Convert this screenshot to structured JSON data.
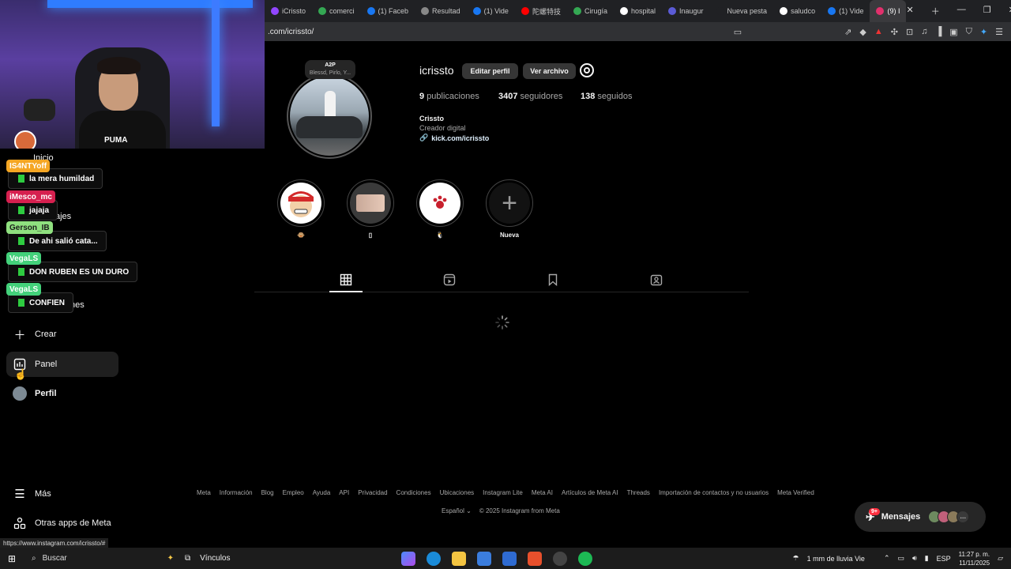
{
  "browser": {
    "tabs": [
      {
        "label": "iCrissto",
        "color": "#9146ff"
      },
      {
        "label": "comerci",
        "color": "#34a853"
      },
      {
        "label": "(1) Faceb",
        "color": "#1877f2"
      },
      {
        "label": "Resultad",
        "color": "#888888"
      },
      {
        "label": "(1) Vide",
        "color": "#1877f2"
      },
      {
        "label": "陀螺特技",
        "color": "#ff0000"
      },
      {
        "label": "Cirugía",
        "color": "#34a853"
      },
      {
        "label": "hospital",
        "color": "#ffffff"
      },
      {
        "label": "Inaugur",
        "color": "#5b5bd6"
      },
      {
        "label": "Nueva pesta",
        "color": "#202124"
      },
      {
        "label": "saludco",
        "color": "#ffffff"
      },
      {
        "label": "(1) Vide",
        "color": "#1877f2"
      },
      {
        "label": "(9) I",
        "color": "#e1306c"
      }
    ],
    "address": ".com/icrissto/",
    "status_url": "https://www.instagram.com/icrissto/#"
  },
  "stream": {
    "shirt_text": "PUMA",
    "chat": [
      {
        "user": "IS4NTYoff",
        "user_color": "#f5a623",
        "text_color": "#ffffff",
        "msg": "la mera humildad"
      },
      {
        "user": "iMesco_mc",
        "user_color": "#d6204f",
        "text_color": "#ffffff",
        "msg": "jajaja"
      },
      {
        "user": "Gerson_IB",
        "user_color": "#8fe07f",
        "text_color": "#1b1b1b",
        "msg": "De ahi salió cata..."
      },
      {
        "user": "VegaLS",
        "user_color": "#43d17a",
        "text_color": "#ffffff",
        "msg": "DON RUBEN ES UN DURO"
      },
      {
        "user": "VegaLS",
        "user_color": "#43d17a",
        "text_color": "#ffffff",
        "msg": "CONFIEN"
      }
    ]
  },
  "sidebar": {
    "ghost": [
      "Inicio",
      "ajes",
      "nes"
    ],
    "items": [
      {
        "label": "Crear",
        "icon": "plus-icon"
      },
      {
        "label": "Panel",
        "icon": "dashboard-icon"
      },
      {
        "label": "Perfil",
        "icon": "avatar"
      },
      {
        "label": "Más",
        "icon": "menu-icon"
      },
      {
        "label": "Otras apps de Meta",
        "icon": "apps-icon"
      }
    ]
  },
  "profile": {
    "username": "icrissto",
    "edit_label": "Editar perfil",
    "archive_label": "Ver archivo",
    "note_title": "A2P",
    "note_sub": "Blessd, Pirlo, Y...",
    "posts_count": "9",
    "posts_label": "publicaciones",
    "followers_count": "3407",
    "followers_label": "seguidores",
    "following_count": "138",
    "following_label": "seguidos",
    "full_name": "Crissto",
    "category": "Creador digital",
    "link": "kick.com/icrissto",
    "highlights": [
      {
        "label": "🐵"
      },
      {
        "label": "▯"
      },
      {
        "label": "🐧"
      },
      {
        "label": "Nueva"
      }
    ]
  },
  "footer": {
    "links": [
      "Meta",
      "Información",
      "Blog",
      "Empleo",
      "Ayuda",
      "API",
      "Privacidad",
      "Condiciones",
      "Ubicaciones",
      "Instagram Lite",
      "Meta AI",
      "Artículos de Meta AI",
      "Threads",
      "Importación de contactos y no usuarios",
      "Meta Verified"
    ],
    "language": "Español",
    "copyright": "© 2025 Instagram from Meta"
  },
  "messages": {
    "label": "Mensajes",
    "badge": "9+"
  },
  "taskbar": {
    "search": "Buscar",
    "vinculos": "Vínculos",
    "weather": "1 mm de lluvia Vie",
    "lang": "ESP",
    "time": "11:27 p. m.",
    "date": "11/11/2025"
  }
}
